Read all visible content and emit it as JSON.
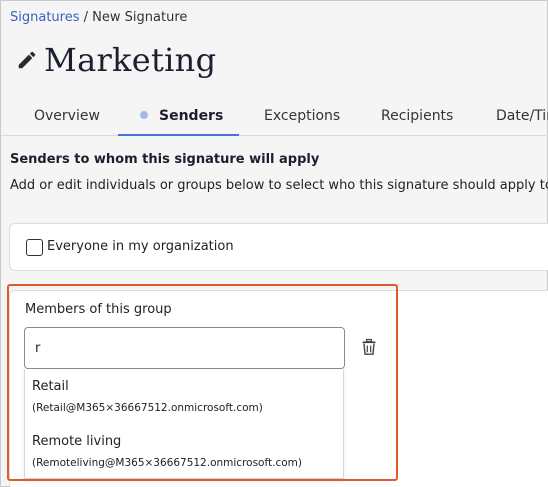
{
  "breadcrumb": {
    "link": "Signatures",
    "separator": "/",
    "current": "New Signature"
  },
  "page_title": "Marketing",
  "title_icon": "pencil-icon",
  "tabs": [
    {
      "label": "Overview",
      "active": false
    },
    {
      "label": "Senders",
      "active": true
    },
    {
      "label": "Exceptions",
      "active": false
    },
    {
      "label": "Recipients",
      "active": false
    },
    {
      "label": "Date/Tim",
      "active": false
    }
  ],
  "section": {
    "heading": "Senders to whom this signature will apply",
    "description": "Add or edit individuals or groups below to select who this signature should apply to"
  },
  "everyone": {
    "label": "Everyone in my organization",
    "checked": false
  },
  "group": {
    "label": "Members of this group",
    "search_value": "r",
    "delete_icon": "trash-icon",
    "suggestions": [
      {
        "name": "Retail",
        "email": "(Retail@M365×36667512.onmicrosoft.com)"
      },
      {
        "name": "Remote living",
        "email": "(Remoteliving@M365×36667512.onmicrosoft.com)"
      }
    ]
  },
  "colors": {
    "link": "#3a5fbf",
    "active_tab_underline": "#4a6fdc",
    "active_tab_dot": "#a9b6ec",
    "highlight_border": "#e05a2b"
  }
}
